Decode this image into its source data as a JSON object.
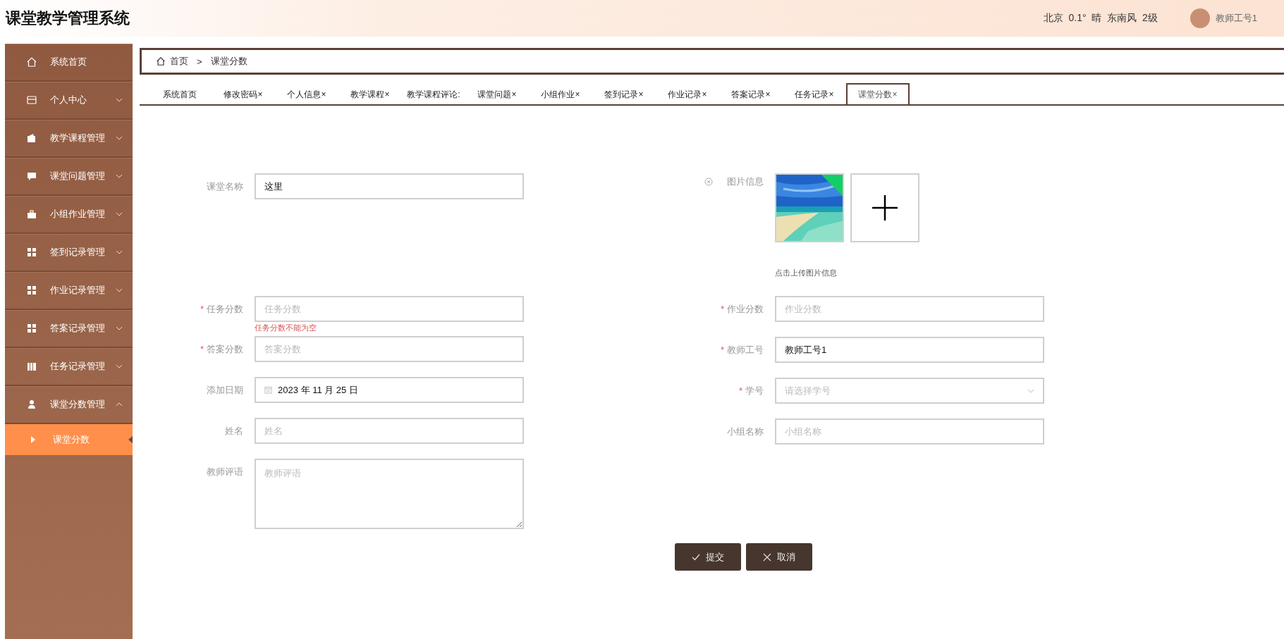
{
  "header": {
    "title": "课堂教学管理系统",
    "weather": "北京  0.1°  晴  东南风  2级",
    "user": "教师工号1"
  },
  "sidebar": {
    "items": [
      {
        "label": "系统首页",
        "kind": "link"
      },
      {
        "label": "个人中心",
        "kind": "menu",
        "expanded": false
      },
      {
        "label": "教学课程管理",
        "kind": "menu",
        "expanded": false
      },
      {
        "label": "课堂问题管理",
        "kind": "menu",
        "expanded": false
      },
      {
        "label": "小组作业管理",
        "kind": "menu",
        "expanded": false
      },
      {
        "label": "签到记录管理",
        "kind": "menu",
        "expanded": false
      },
      {
        "label": "作业记录管理",
        "kind": "menu",
        "expanded": false
      },
      {
        "label": "答案记录管理",
        "kind": "menu",
        "expanded": false
      },
      {
        "label": "任务记录管理",
        "kind": "menu",
        "expanded": false
      },
      {
        "label": "课堂分数管理",
        "kind": "menu",
        "expanded": true,
        "children": [
          {
            "label": "课堂分数",
            "selected": true
          }
        ]
      }
    ]
  },
  "breadcrumb": {
    "items": [
      {
        "label": "首页"
      },
      {
        "label": "课堂分数"
      }
    ],
    "separator": ">"
  },
  "tabs": [
    {
      "label": "系统首页",
      "selected": false
    },
    {
      "label": "修改密码×",
      "selected": false
    },
    {
      "label": "个人信息×",
      "selected": false
    },
    {
      "label": "教学课程×",
      "selected": false
    },
    {
      "label": "教学课程评论:",
      "selected": false
    },
    {
      "label": "课堂问题×",
      "selected": false
    },
    {
      "label": "小组作业×",
      "selected": false
    },
    {
      "label": "签到记录×",
      "selected": false
    },
    {
      "label": "作业记录×",
      "selected": false
    },
    {
      "label": "答案记录×",
      "selected": false
    },
    {
      "label": "任务记录×",
      "selected": false
    },
    {
      "label": "课堂分数×",
      "selected": true
    }
  ],
  "form": {
    "left": [
      {
        "kind": "text",
        "label": "课堂名称",
        "value": "这里"
      },
      {
        "kind": "text",
        "label": "任务分数",
        "required_mark": "*",
        "placeholder": "任务分数",
        "error": "任务分数不能为空"
      },
      {
        "kind": "text",
        "label": "答案分数",
        "required_mark": "*",
        "placeholder": "答案分数"
      },
      {
        "kind": "date",
        "label": "添加日期",
        "value": "2023 年 11 月 25 日"
      },
      {
        "kind": "text",
        "label": "姓名",
        "placeholder": "姓名"
      },
      {
        "kind": "textarea",
        "label": "教师评语",
        "placeholder": "教师评语"
      }
    ],
    "image": {
      "label": "图片信息",
      "hint": "点击上传图片信息",
      "images": [
        {
          "kind": "picture",
          "uploaded": true
        }
      ]
    },
    "right": [
      {
        "kind": "text",
        "label": "作业分数",
        "required_mark": "*",
        "placeholder": "作业分数"
      },
      {
        "kind": "text",
        "label": "教师工号",
        "required_mark": "*",
        "value": "教师工号1"
      },
      {
        "kind": "select",
        "label": "学号",
        "required_mark": "*",
        "placeholder": "请选择学号"
      },
      {
        "kind": "text",
        "label": "小组名称",
        "placeholder": "小组名称"
      }
    ]
  },
  "buttons": [
    {
      "label": "提交",
      "kind": "submit"
    },
    {
      "label": "取消",
      "kind": "cancel"
    }
  ]
}
